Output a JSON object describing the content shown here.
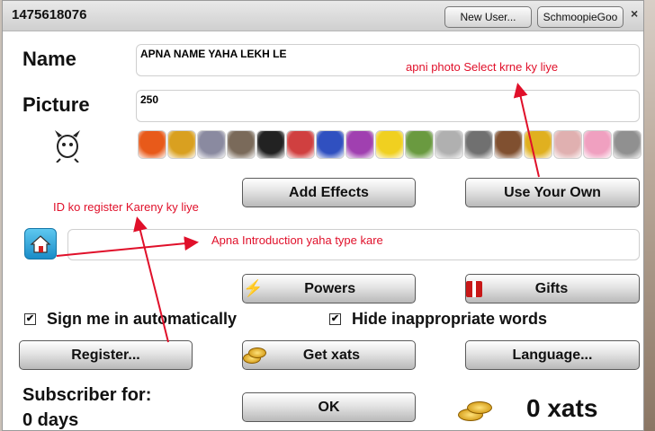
{
  "window": {
    "title": "1475618076"
  },
  "titlebar": {
    "new_user_label": "New User...",
    "profile_label": "SchmoopieGoo"
  },
  "form": {
    "name_label": "Name",
    "name_value": "APNA NAME YAHA LEKH LE",
    "picture_label": "Picture",
    "picture_value": "250"
  },
  "avatars": {
    "items": [
      {
        "icon": "garfield-avatar-icon",
        "color": "#e85a1a"
      },
      {
        "icon": "c3po-avatar-icon",
        "color": "#d9a020"
      },
      {
        "icon": "spaceship-avatar-icon",
        "color": "#8a8aa0"
      },
      {
        "icon": "bird-avatar-icon",
        "color": "#7a6a5a"
      },
      {
        "icon": "dc-logo-avatar-icon",
        "color": "#222222"
      },
      {
        "icon": "girl-avatar-icon",
        "color": "#d04040"
      },
      {
        "icon": "blue-hair-avatar-icon",
        "color": "#3050c0"
      },
      {
        "icon": "purple-avatar-icon",
        "color": "#a040b0"
      },
      {
        "icon": "tweety-avatar-icon",
        "color": "#f0d020"
      },
      {
        "icon": "frankenstein-avatar-icon",
        "color": "#6a9a40"
      },
      {
        "icon": "ultraman-avatar-icon",
        "color": "#b0b0b0"
      },
      {
        "icon": "alien-avatar-icon",
        "color": "#707070"
      },
      {
        "icon": "detective-avatar-icon",
        "color": "#805030"
      },
      {
        "icon": "pikachu-avatar-icon",
        "color": "#e0b020"
      },
      {
        "icon": "bird-white-avatar-icon",
        "color": "#e0b0b0"
      },
      {
        "icon": "pig-avatar-icon",
        "color": "#f0a0c0"
      },
      {
        "icon": "bug-avatar-icon",
        "color": "#909090"
      }
    ]
  },
  "buttons": {
    "add_effects": "Add Effects",
    "use_your_own": "Use Your Own",
    "powers": "Powers",
    "gifts": "Gifts",
    "register": "Register...",
    "get_xats": "Get xats",
    "language": "Language...",
    "ok": "OK"
  },
  "notes": {
    "photo_note": "apni photo Select krne ky liye",
    "register_note": "ID ko register Kareny ky liye",
    "intro_note": "Apna Introduction yaha type kare"
  },
  "checkboxes": {
    "sign_in_label": "Sign me in automatically",
    "sign_in_checked": true,
    "hide_words_label": "Hide inappropriate words",
    "hide_words_checked": true
  },
  "footer": {
    "subscriber_label": "Subscriber for:",
    "subscriber_days": "0 days",
    "xats_amount": "0 xats"
  },
  "colors": {
    "annotation": "#e0102a",
    "home_button": "#1aa0d8"
  }
}
